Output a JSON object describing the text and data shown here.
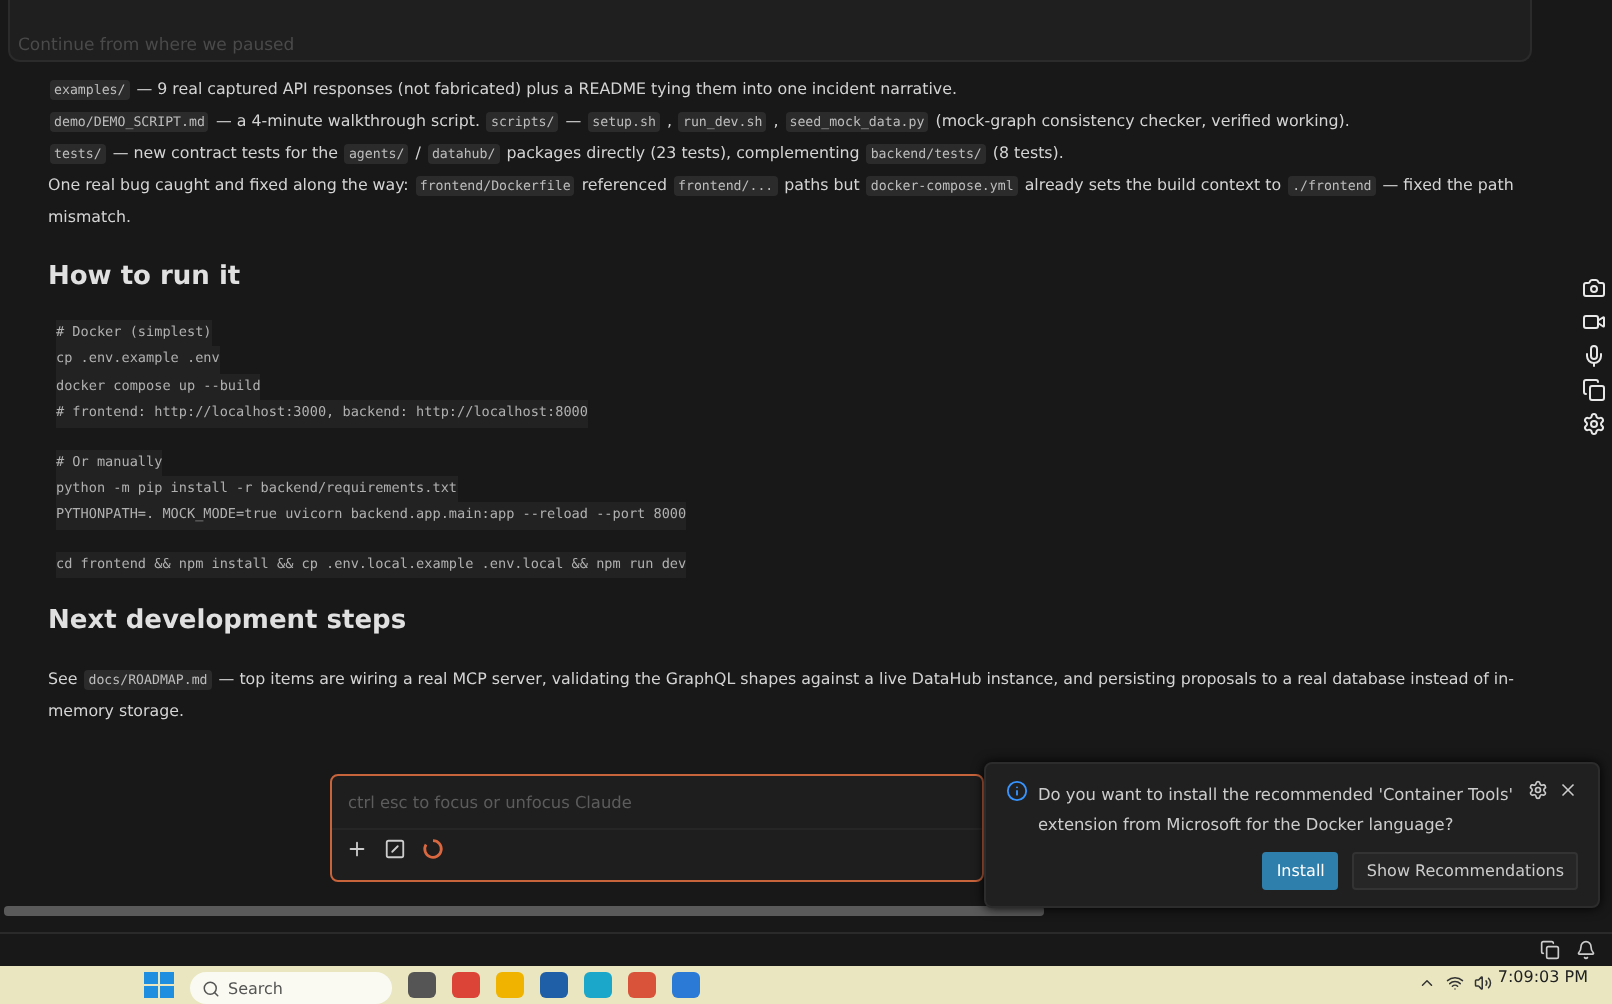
{
  "resume_banner": {
    "text": "Continue from where we paused"
  },
  "paragraphs": [
    [
      {
        "kind": "code",
        "text": "examples/"
      },
      {
        "kind": "text",
        "text": "— 9 real captured API responses (not fabricated) plus a README tying them into one incident narrative."
      }
    ],
    [
      {
        "kind": "code",
        "text": "demo/DEMO_SCRIPT.md"
      },
      {
        "kind": "text",
        "text": "— a 4-minute walkthrough script."
      },
      {
        "kind": "code",
        "text": "scripts/"
      },
      {
        "kind": "text",
        "text": "—"
      },
      {
        "kind": "code",
        "text": "setup.sh"
      },
      {
        "kind": "text",
        "text": ","
      },
      {
        "kind": "code",
        "text": "run_dev.sh"
      },
      {
        "kind": "text",
        "text": ","
      },
      {
        "kind": "code",
        "text": "seed_mock_data.py"
      },
      {
        "kind": "text",
        "text": "(mock-graph consistency checker, verified working)."
      }
    ],
    [
      {
        "kind": "code",
        "text": "tests/"
      },
      {
        "kind": "text",
        "text": "— new contract tests for the"
      },
      {
        "kind": "code",
        "text": "agents/"
      },
      {
        "kind": "text",
        "text": "/"
      },
      {
        "kind": "code",
        "text": "datahub/"
      },
      {
        "kind": "text",
        "text": "packages directly (23 tests), complementing"
      },
      {
        "kind": "code",
        "text": "backend/tests/"
      },
      {
        "kind": "text",
        "text": "(8 tests)."
      }
    ],
    [
      {
        "kind": "text",
        "text": "One real bug caught and fixed along the way:"
      },
      {
        "kind": "code",
        "text": "frontend/Dockerfile"
      },
      {
        "kind": "text",
        "text": "referenced"
      },
      {
        "kind": "code",
        "text": "frontend/..."
      },
      {
        "kind": "text",
        "text": "paths but"
      },
      {
        "kind": "code",
        "text": "docker-compose.yml"
      },
      {
        "kind": "text",
        "text": "already sets the build context to"
      },
      {
        "kind": "code",
        "text": "./frontend"
      },
      {
        "kind": "text",
        "text": "— fixed the path mismatch."
      }
    ]
  ],
  "sections": [
    {
      "heading": "How to run it",
      "code_blocks": [
        [
          "# Docker (simplest)",
          "cp .env.example .env",
          "docker compose up --build",
          "# frontend: http://localhost:3000, backend: http://localhost:8000"
        ],
        [
          "# Or manually",
          "python -m pip install -r backend/requirements.txt",
          "PYTHONPATH=. MOCK_MODE=true uvicorn backend.app.main:app --reload --port 8000"
        ],
        [
          "cd frontend && npm install && cp .env.local.example .env.local && npm run dev"
        ]
      ]
    },
    {
      "heading": "Next development steps",
      "paragraph": [
        {
          "kind": "text",
          "text": "See"
        },
        {
          "kind": "code",
          "text": "docs/ROADMAP.md"
        },
        {
          "kind": "text",
          "text": "— top items are wiring a real MCP server, validating the GraphQL shapes against a live DataHub instance, and persisting proposals to a real database instead of in-memory storage."
        }
      ]
    }
  ],
  "prompt": {
    "placeholder": "ctrl esc to focus or unfocus Claude"
  },
  "notification": {
    "message": "Do you want to install the recommended 'Container Tools' extension from Microsoft for the Docker language?",
    "buttons": [
      {
        "label": "Install",
        "primary": true
      },
      {
        "label": "Show Recommendations",
        "primary": false
      }
    ]
  },
  "taskbar": {
    "search_placeholder": "Search",
    "clock": "7:09:03 PM"
  }
}
